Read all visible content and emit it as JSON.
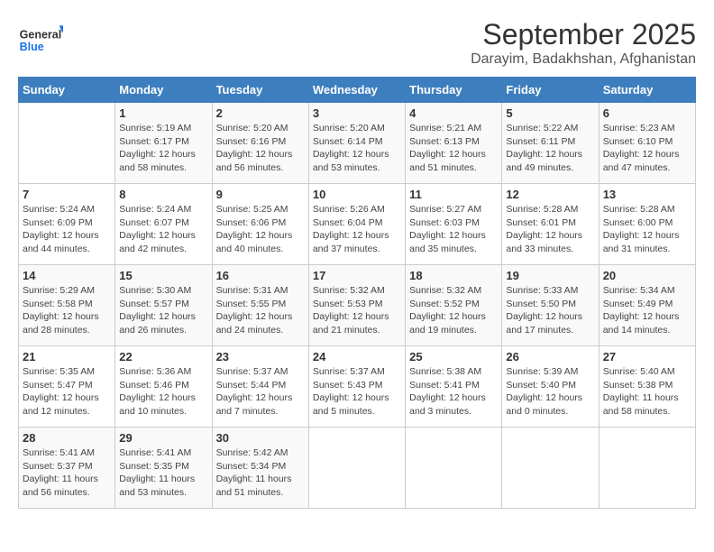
{
  "logo": {
    "line1": "General",
    "line2": "Blue"
  },
  "title": "September 2025",
  "subtitle": "Darayim, Badakhshan, Afghanistan",
  "weekdays": [
    "Sunday",
    "Monday",
    "Tuesday",
    "Wednesday",
    "Thursday",
    "Friday",
    "Saturday"
  ],
  "weeks": [
    [
      {
        "day": "",
        "info": ""
      },
      {
        "day": "1",
        "info": "Sunrise: 5:19 AM\nSunset: 6:17 PM\nDaylight: 12 hours\nand 58 minutes."
      },
      {
        "day": "2",
        "info": "Sunrise: 5:20 AM\nSunset: 6:16 PM\nDaylight: 12 hours\nand 56 minutes."
      },
      {
        "day": "3",
        "info": "Sunrise: 5:20 AM\nSunset: 6:14 PM\nDaylight: 12 hours\nand 53 minutes."
      },
      {
        "day": "4",
        "info": "Sunrise: 5:21 AM\nSunset: 6:13 PM\nDaylight: 12 hours\nand 51 minutes."
      },
      {
        "day": "5",
        "info": "Sunrise: 5:22 AM\nSunset: 6:11 PM\nDaylight: 12 hours\nand 49 minutes."
      },
      {
        "day": "6",
        "info": "Sunrise: 5:23 AM\nSunset: 6:10 PM\nDaylight: 12 hours\nand 47 minutes."
      }
    ],
    [
      {
        "day": "7",
        "info": "Sunrise: 5:24 AM\nSunset: 6:09 PM\nDaylight: 12 hours\nand 44 minutes."
      },
      {
        "day": "8",
        "info": "Sunrise: 5:24 AM\nSunset: 6:07 PM\nDaylight: 12 hours\nand 42 minutes."
      },
      {
        "day": "9",
        "info": "Sunrise: 5:25 AM\nSunset: 6:06 PM\nDaylight: 12 hours\nand 40 minutes."
      },
      {
        "day": "10",
        "info": "Sunrise: 5:26 AM\nSunset: 6:04 PM\nDaylight: 12 hours\nand 37 minutes."
      },
      {
        "day": "11",
        "info": "Sunrise: 5:27 AM\nSunset: 6:03 PM\nDaylight: 12 hours\nand 35 minutes."
      },
      {
        "day": "12",
        "info": "Sunrise: 5:28 AM\nSunset: 6:01 PM\nDaylight: 12 hours\nand 33 minutes."
      },
      {
        "day": "13",
        "info": "Sunrise: 5:28 AM\nSunset: 6:00 PM\nDaylight: 12 hours\nand 31 minutes."
      }
    ],
    [
      {
        "day": "14",
        "info": "Sunrise: 5:29 AM\nSunset: 5:58 PM\nDaylight: 12 hours\nand 28 minutes."
      },
      {
        "day": "15",
        "info": "Sunrise: 5:30 AM\nSunset: 5:57 PM\nDaylight: 12 hours\nand 26 minutes."
      },
      {
        "day": "16",
        "info": "Sunrise: 5:31 AM\nSunset: 5:55 PM\nDaylight: 12 hours\nand 24 minutes."
      },
      {
        "day": "17",
        "info": "Sunrise: 5:32 AM\nSunset: 5:53 PM\nDaylight: 12 hours\nand 21 minutes."
      },
      {
        "day": "18",
        "info": "Sunrise: 5:32 AM\nSunset: 5:52 PM\nDaylight: 12 hours\nand 19 minutes."
      },
      {
        "day": "19",
        "info": "Sunrise: 5:33 AM\nSunset: 5:50 PM\nDaylight: 12 hours\nand 17 minutes."
      },
      {
        "day": "20",
        "info": "Sunrise: 5:34 AM\nSunset: 5:49 PM\nDaylight: 12 hours\nand 14 minutes."
      }
    ],
    [
      {
        "day": "21",
        "info": "Sunrise: 5:35 AM\nSunset: 5:47 PM\nDaylight: 12 hours\nand 12 minutes."
      },
      {
        "day": "22",
        "info": "Sunrise: 5:36 AM\nSunset: 5:46 PM\nDaylight: 12 hours\nand 10 minutes."
      },
      {
        "day": "23",
        "info": "Sunrise: 5:37 AM\nSunset: 5:44 PM\nDaylight: 12 hours\nand 7 minutes."
      },
      {
        "day": "24",
        "info": "Sunrise: 5:37 AM\nSunset: 5:43 PM\nDaylight: 12 hours\nand 5 minutes."
      },
      {
        "day": "25",
        "info": "Sunrise: 5:38 AM\nSunset: 5:41 PM\nDaylight: 12 hours\nand 3 minutes."
      },
      {
        "day": "26",
        "info": "Sunrise: 5:39 AM\nSunset: 5:40 PM\nDaylight: 12 hours\nand 0 minutes."
      },
      {
        "day": "27",
        "info": "Sunrise: 5:40 AM\nSunset: 5:38 PM\nDaylight: 11 hours\nand 58 minutes."
      }
    ],
    [
      {
        "day": "28",
        "info": "Sunrise: 5:41 AM\nSunset: 5:37 PM\nDaylight: 11 hours\nand 56 minutes."
      },
      {
        "day": "29",
        "info": "Sunrise: 5:41 AM\nSunset: 5:35 PM\nDaylight: 11 hours\nand 53 minutes."
      },
      {
        "day": "30",
        "info": "Sunrise: 5:42 AM\nSunset: 5:34 PM\nDaylight: 11 hours\nand 51 minutes."
      },
      {
        "day": "",
        "info": ""
      },
      {
        "day": "",
        "info": ""
      },
      {
        "day": "",
        "info": ""
      },
      {
        "day": "",
        "info": ""
      }
    ]
  ]
}
